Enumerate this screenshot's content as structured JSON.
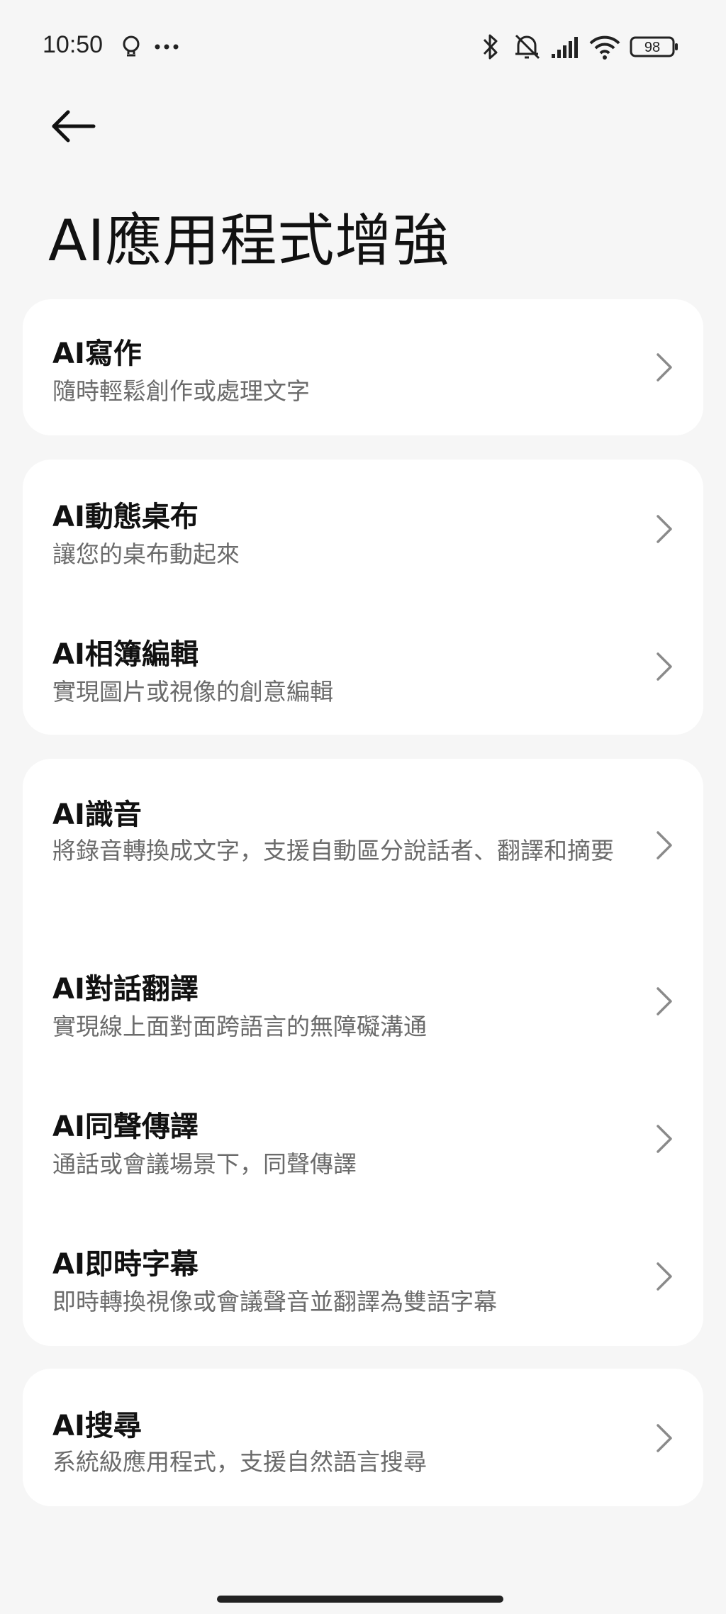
{
  "status_bar": {
    "time": "10:50",
    "battery": "98",
    "icons": [
      "lightbulb-icon",
      "more-dots-icon",
      "bluetooth-icon",
      "mute-bell-icon",
      "signal-icon",
      "wifi-icon",
      "battery-icon"
    ]
  },
  "header": {
    "back_icon": "arrow-left-icon",
    "title": "AI應用程式增強"
  },
  "cards": [
    {
      "items": [
        {
          "title": "AI寫作",
          "desc": "隨時輕鬆創作或處理文字"
        }
      ]
    },
    {
      "items": [
        {
          "title": "AI動態桌布",
          "desc": "讓您的桌布動起來"
        },
        {
          "title": "AI相簿編輯",
          "desc": "實現圖片或視像的創意編輯"
        }
      ]
    },
    {
      "items": [
        {
          "title": "AI識音",
          "desc": "將錄音轉換成文字，支援自動區分說話者、翻譯和摘要"
        },
        {
          "title": "AI對話翻譯",
          "desc": "實現線上面對面跨語言的無障礙溝通"
        },
        {
          "title": "AI同聲傳譯",
          "desc": "通話或會議場景下，同聲傳譯"
        },
        {
          "title": "AI即時字幕",
          "desc": "即時轉換視像或會議聲音並翻譯為雙語字幕"
        }
      ]
    },
    {
      "items": [
        {
          "title": "AI搜尋",
          "desc": "系統級應用程式，支援自然語言搜尋"
        }
      ]
    }
  ],
  "colors": {
    "background": "#f6f6f6",
    "card": "#ffffff",
    "title_text": "#111111",
    "desc_text": "#6b6b6b",
    "chevron": "#8a8a8a"
  }
}
